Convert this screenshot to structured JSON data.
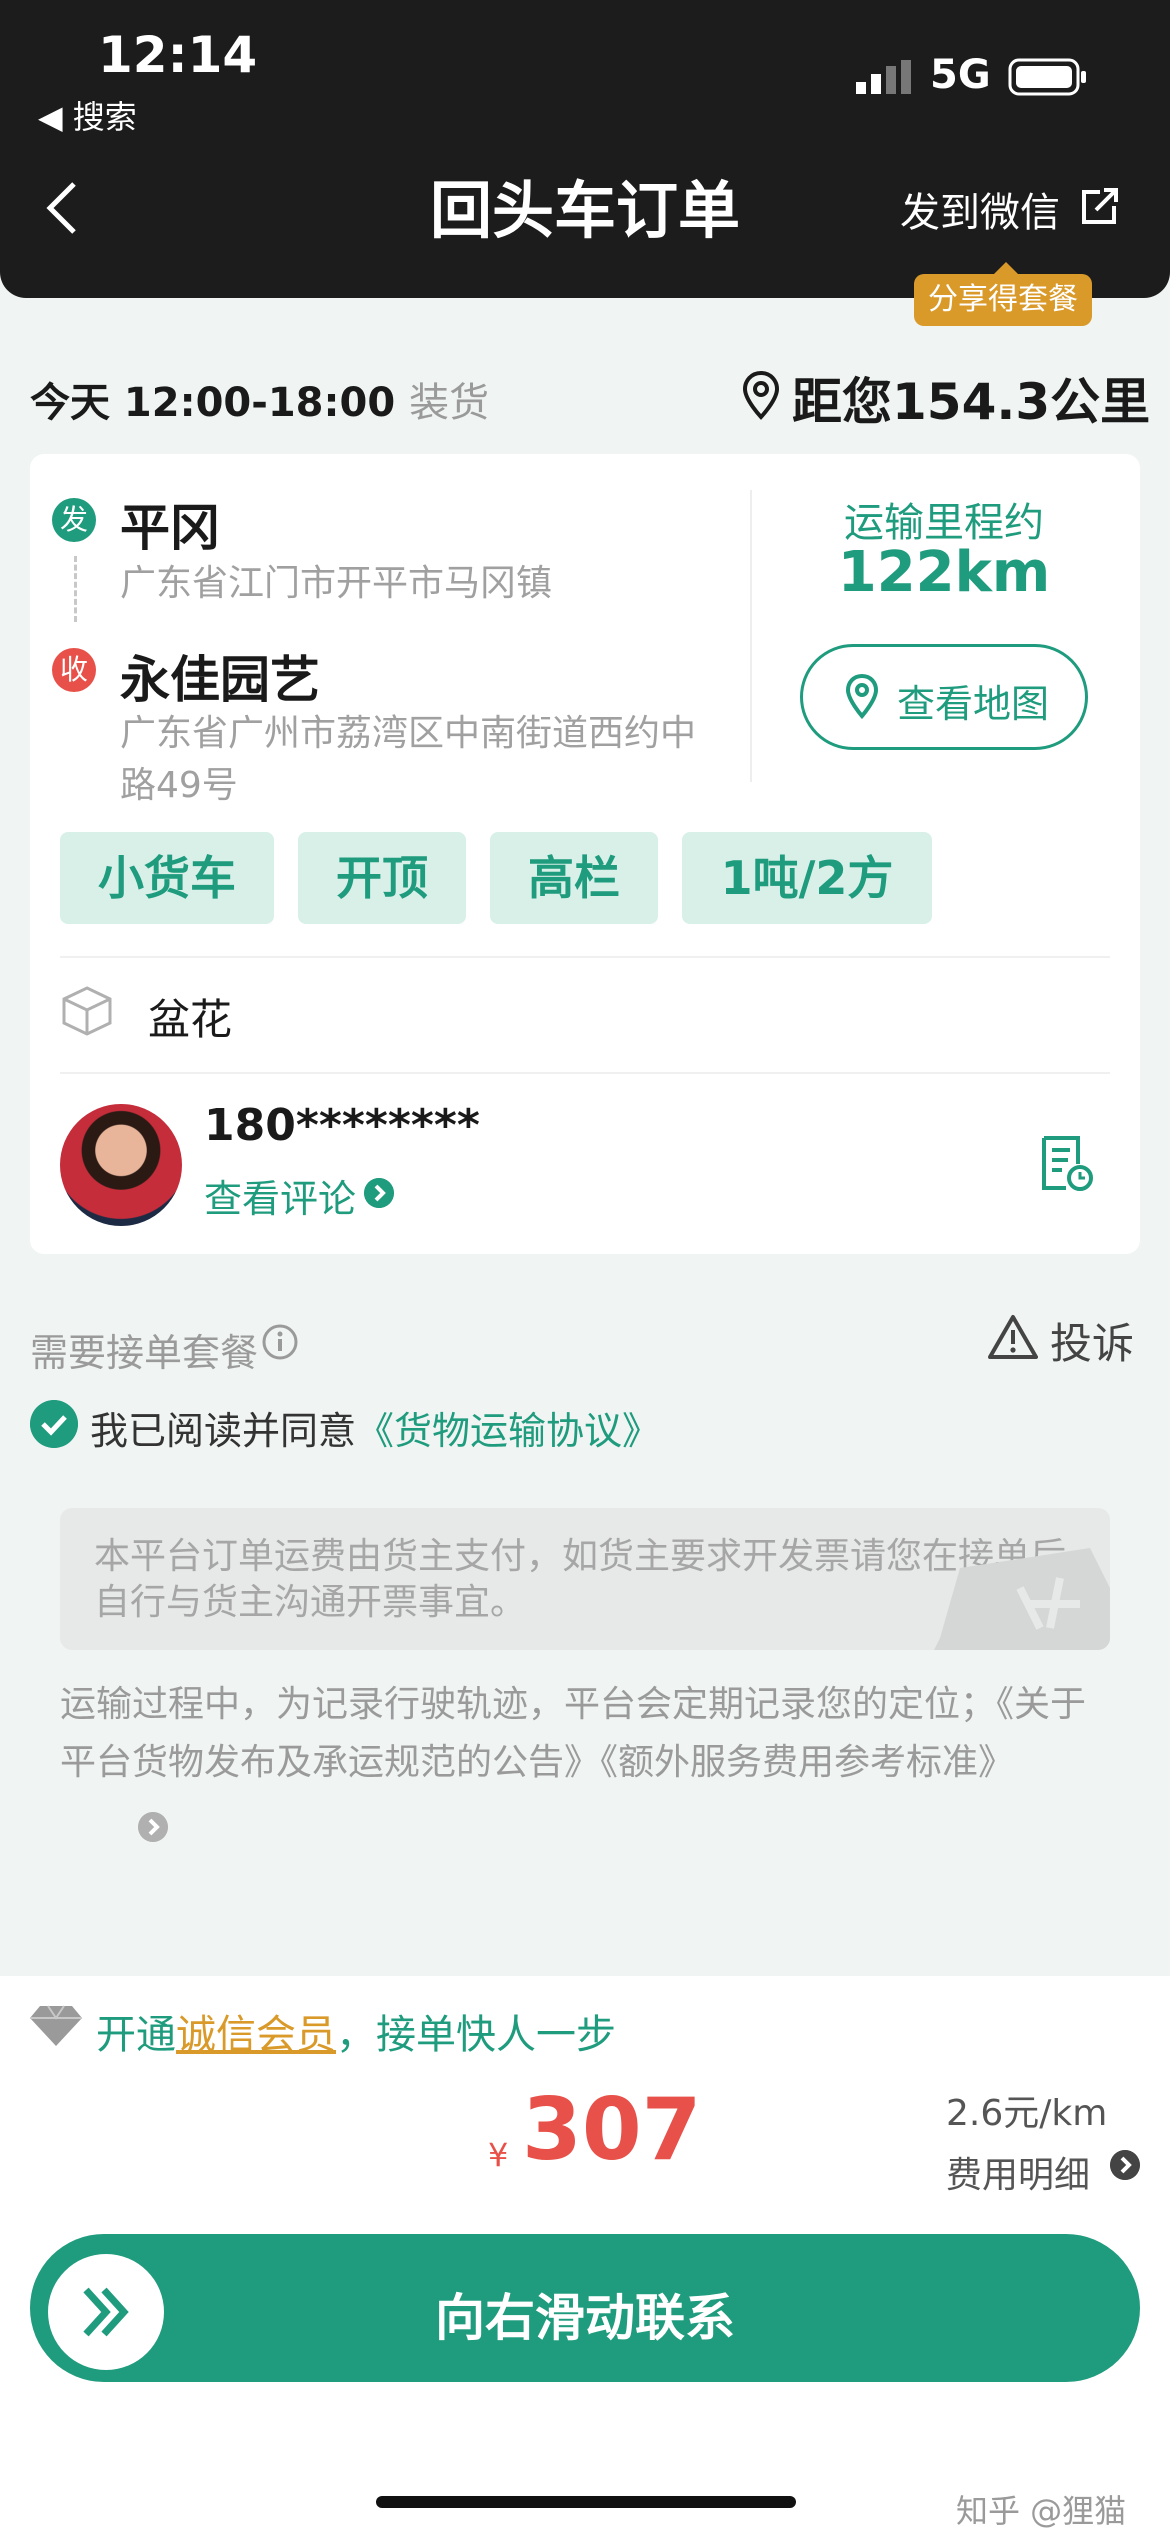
{
  "status_bar": {
    "time": "12:14",
    "back_app": "◀ 搜索",
    "network": "5G"
  },
  "nav": {
    "title": "回头车订单",
    "share": "发到微信",
    "share_badge": "分享得套餐"
  },
  "load": {
    "time": "今天 12:00-18:00",
    "suffix": "装货",
    "distance": "距您154.3公里"
  },
  "route": {
    "from_tag": "发",
    "from_name": "平冈",
    "from_addr": "广东省江门市开平市马冈镇",
    "to_tag": "收",
    "to_name": "永佳园艺",
    "to_addr": "广东省广州市荔湾区中南街道西约中路49号",
    "mileage_label": "运输里程约",
    "mileage_value": "122km",
    "map_button": "查看地图"
  },
  "tags": [
    "小货车",
    "开顶",
    "高栏",
    "1吨/2方"
  ],
  "goods": "盆花",
  "driver": {
    "phone": "180********",
    "reviews": "查看评论"
  },
  "options": {
    "need_package": "需要接单套餐",
    "complain": "投诉",
    "agree_text": "我已阅读并同意",
    "agreement_link": "《货物运输协议》"
  },
  "notice": "本平台订单运费由货主支付，如货主要求开发票请您在接单后自行与货主沟通开票事宜。",
  "disclaimer": "运输过程中，为记录行驶轨迹，平台会定期记录您的定位；《关于平台货物发布及承运规范的公告》《额外服务费用参考标准》",
  "footer": {
    "member_prefix": "开通",
    "member_link": "诚信会员",
    "member_suffix": "，接单快人一步",
    "currency": "¥",
    "price": "307",
    "rate": "2.6元/km",
    "fee_detail": "费用明细",
    "slide_label": "向右滑动联系"
  },
  "watermark": "知乎 @狸猫",
  "colors": {
    "accent": "#1f9b7e",
    "price": "#e8514a",
    "badge": "#d99a2a",
    "header": "#1c1c1c"
  }
}
